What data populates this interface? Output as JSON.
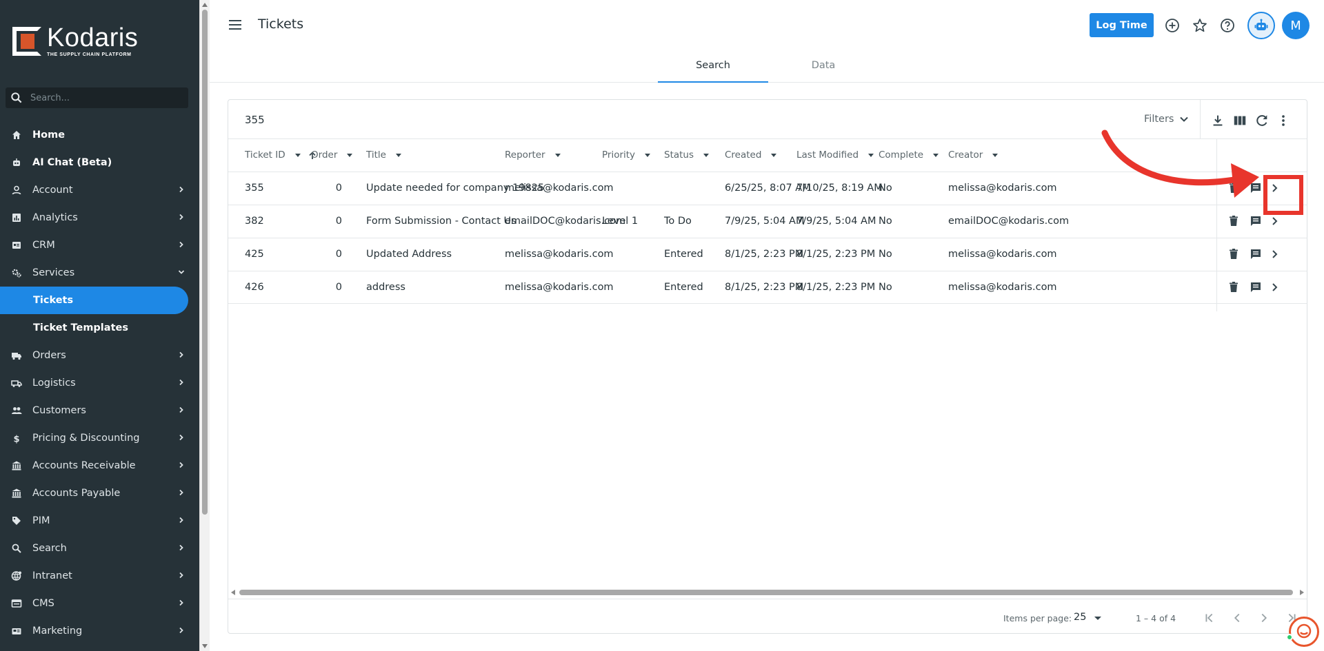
{
  "brand": {
    "name": "Kodaris",
    "tagline": "THE SUPPLY CHAIN PLATFORM"
  },
  "sidebar": {
    "search_placeholder": "Search...",
    "items": [
      {
        "label": "Home",
        "icon": "home-icon"
      },
      {
        "label": "AI Chat (Beta)",
        "icon": "robot-icon"
      },
      {
        "label": "Account",
        "icon": "person-icon"
      },
      {
        "label": "Analytics",
        "icon": "analytics-icon"
      },
      {
        "label": "CRM",
        "icon": "crm-icon"
      },
      {
        "label": "Services",
        "icon": "gear-icon"
      },
      {
        "label": "Tickets",
        "icon": ""
      },
      {
        "label": "Ticket Templates",
        "icon": ""
      },
      {
        "label": "Orders",
        "icon": "truck-icon"
      },
      {
        "label": "Logistics",
        "icon": "shipping-icon"
      },
      {
        "label": "Customers",
        "icon": "people-icon"
      },
      {
        "label": "Pricing & Discounting",
        "icon": "dollar-icon"
      },
      {
        "label": "Accounts Receivable",
        "icon": "bank-icon"
      },
      {
        "label": "Accounts Payable",
        "icon": "bank-icon"
      },
      {
        "label": "PIM",
        "icon": "tag-icon"
      },
      {
        "label": "Search",
        "icon": "search-icon"
      },
      {
        "label": "Intranet",
        "icon": "globe-icon"
      },
      {
        "label": "CMS",
        "icon": "cms-icon"
      },
      {
        "label": "Marketing",
        "icon": "marketing-icon"
      }
    ]
  },
  "header": {
    "title": "Tickets",
    "log_time_label": "Log Time",
    "avatar_initial": "M"
  },
  "tabs": [
    {
      "label": "Search"
    },
    {
      "label": "Data"
    }
  ],
  "toolbar": {
    "count": "355",
    "filters_label": "Filters"
  },
  "table": {
    "columns": [
      "Ticket ID",
      "Order",
      "Title",
      "Reporter",
      "Priority",
      "Status",
      "Created",
      "Last Modified",
      "Complete",
      "Creator"
    ],
    "rows": [
      [
        "355",
        "0",
        "Update needed for company 19825",
        "melissa@kodaris.com",
        "",
        "",
        "6/25/25, 8:07 AM",
        "7/10/25, 8:19 AM",
        "No",
        "melissa@kodaris.com"
      ],
      [
        "382",
        "0",
        "Form Submission - Contact Us",
        "emailDOC@kodaris.com",
        "Level 1",
        "To Do",
        "7/9/25, 5:04 AM",
        "7/9/25, 5:04 AM",
        "No",
        "emailDOC@kodaris.com"
      ],
      [
        "425",
        "0",
        "Updated Address",
        "melissa@kodaris.com",
        "",
        "Entered",
        "8/1/25, 2:23 PM",
        "8/1/25, 2:23 PM",
        "No",
        "melissa@kodaris.com"
      ],
      [
        "426",
        "0",
        "address",
        "melissa@kodaris.com",
        "",
        "Entered",
        "8/1/25, 2:23 PM",
        "8/1/25, 2:23 PM",
        "No",
        "melissa@kodaris.com"
      ]
    ]
  },
  "paginator": {
    "items_per_page_label": "Items per page:",
    "items_per_page": "25",
    "range": "1 – 4 of 4"
  },
  "colors": {
    "sidebar": "#263238",
    "accent": "#1e88e5",
    "annotation": "#e8352c"
  }
}
